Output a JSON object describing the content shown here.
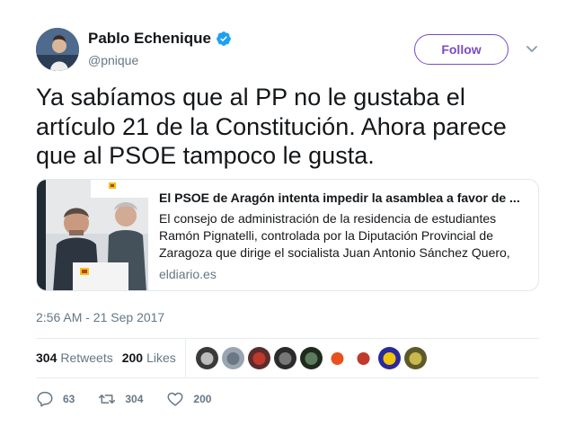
{
  "author": {
    "name": "Pablo Echenique",
    "handle": "@pnique"
  },
  "follow_label": "Follow",
  "tweet_text": "Ya sabíamos que al PP no le gustaba el artículo 21 de la Constitución. Ahora parece que al PSOE tampoco le gusta.",
  "card": {
    "title": "El PSOE de Aragón intenta impedir la asamblea a favor de ...",
    "description": "El consejo de administración de la residencia de estudiantes Ramón Pignatelli, controlada por la Diputación Provincial de Zaragoza que dirige el socialista Juan Antonio Sánchez Quero,",
    "domain": "eldiario.es",
    "image_sign_text": "GOBIERNO DE ARAGON"
  },
  "timestamp": "2:56 AM - 21 Sep 2017",
  "stats": {
    "retweets_count": "304",
    "retweets_label": "Retweets",
    "likes_count": "200",
    "likes_label": "Likes"
  },
  "liker_avatars": [
    {
      "colors": [
        "#3a3a3a",
        "#bdbdbd"
      ]
    },
    {
      "colors": [
        "#9aa5b1",
        "#6b7784"
      ]
    },
    {
      "colors": [
        "#5a2d2d",
        "#c0392b"
      ]
    },
    {
      "colors": [
        "#2b2b2b",
        "#777777"
      ]
    },
    {
      "colors": [
        "#1e2a1e",
        "#5c7a5c"
      ]
    },
    {
      "colors": [
        "#ffffff",
        "#e8501e"
      ]
    },
    {
      "colors": [
        "#ffffff",
        "#c0392b"
      ]
    },
    {
      "colors": [
        "#2a2a9a",
        "#f1c40f"
      ]
    },
    {
      "colors": [
        "#5c5a2a",
        "#c9b84a"
      ]
    }
  ],
  "actions": {
    "replies": "63",
    "retweets": "304",
    "likes": "200"
  },
  "colors": {
    "accent": "#794bc4",
    "verified": "#1da1f2",
    "secondary_text": "#657786"
  },
  "icons": [
    "verified-badge-icon",
    "chevron-down-icon",
    "reply-icon",
    "retweet-icon",
    "heart-icon"
  ]
}
